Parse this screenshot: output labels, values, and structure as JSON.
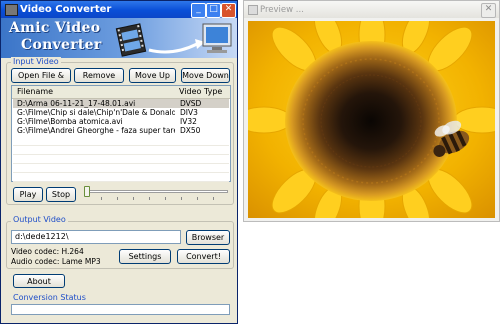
{
  "main_window": {
    "title": "Video Converter",
    "banner": {
      "line1": "Amic Video",
      "line2": "Converter"
    },
    "input_video": {
      "group_label": "Input Video",
      "buttons": {
        "open": "Open File & Add",
        "remove": "Remove",
        "move_up": "Move Up",
        "move_down": "Move Down"
      },
      "columns": [
        "Filename",
        "Video Type"
      ],
      "rows": [
        {
          "filename": "D:\\Arma 06-11-21_17-48.01.avi",
          "type": "DVSD",
          "selected": true
        },
        {
          "filename": "G:\\Filme\\Chip si dale\\Chip'n'Dale & Donald Duck- Te...",
          "type": "DIV3"
        },
        {
          "filename": "G:\\Filme\\Bomba atomica.avi",
          "type": "IV32"
        },
        {
          "filename": "G:\\Filme\\Andrei Gheorghe - faza super tare.avi",
          "type": "DX50"
        }
      ],
      "play": "Play",
      "stop": "Stop"
    },
    "output_video": {
      "group_label": "Output Video",
      "path": "d:\\dede1212\\",
      "browse": "Browser",
      "video_codec": "Video codec: H.264",
      "audio_codec": "Audio codec: Lame MP3",
      "settings": "Settings",
      "convert": "Convert!"
    },
    "about": "About",
    "conversion_status_label": "Conversion Status"
  },
  "preview_window": {
    "title": "Preview ..."
  }
}
